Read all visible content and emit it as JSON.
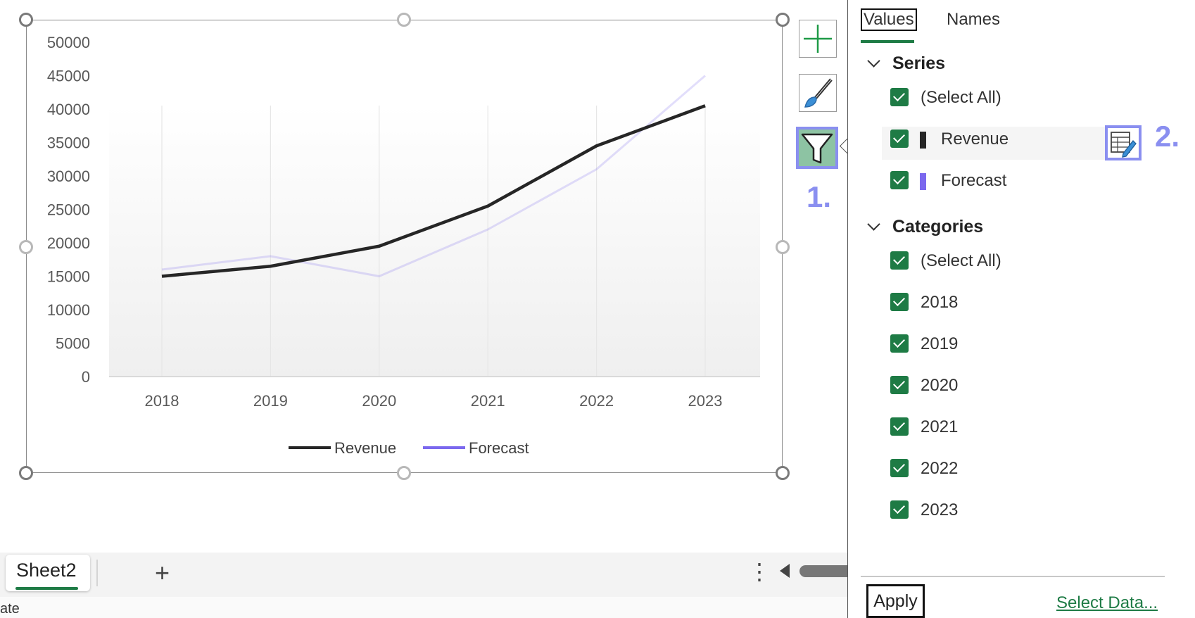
{
  "chart_data": {
    "type": "line",
    "categories": [
      "2018",
      "2019",
      "2020",
      "2021",
      "2022",
      "2023"
    ],
    "series": [
      {
        "name": "Revenue",
        "color": "#262626",
        "values": [
          15000,
          16500,
          19500,
          25500,
          34500,
          40500
        ]
      },
      {
        "name": "Forecast",
        "color": "#7b68ee",
        "values": [
          16000,
          18000,
          15000,
          22000,
          31000,
          45000
        ]
      }
    ],
    "ylim": [
      0,
      50000
    ],
    "yticks": [
      "50000",
      "45000",
      "40000",
      "35000",
      "30000",
      "25000",
      "20000",
      "15000",
      "10000",
      "5000",
      "0"
    ],
    "legend_position": "bottom",
    "grid": "vertical"
  },
  "tools": {
    "markers": {
      "filter": "1.",
      "edit_series": "2."
    }
  },
  "sheet_tabs": {
    "active": "Sheet2",
    "add_symbol": "+",
    "more_symbol": "⋮"
  },
  "status_bar": {
    "text": "ate"
  },
  "filter_pane": {
    "tabs": {
      "values": "Values",
      "names": "Names"
    },
    "series_heading": "Series",
    "series_items": [
      {
        "label": "(Select All)",
        "checked": true
      },
      {
        "label": "Revenue",
        "checked": true,
        "color": "#262626"
      },
      {
        "label": "Forecast",
        "checked": true,
        "color": "#7b68ee"
      }
    ],
    "categories_heading": "Categories",
    "category_items": [
      {
        "label": "(Select All)",
        "checked": true
      },
      {
        "label": "2018",
        "checked": true
      },
      {
        "label": "2019",
        "checked": true
      },
      {
        "label": "2020",
        "checked": true
      },
      {
        "label": "2021",
        "checked": true
      },
      {
        "label": "2022",
        "checked": true
      },
      {
        "label": "2023",
        "checked": true
      }
    ],
    "apply_label": "Apply",
    "select_data_label": "Select Data..."
  }
}
